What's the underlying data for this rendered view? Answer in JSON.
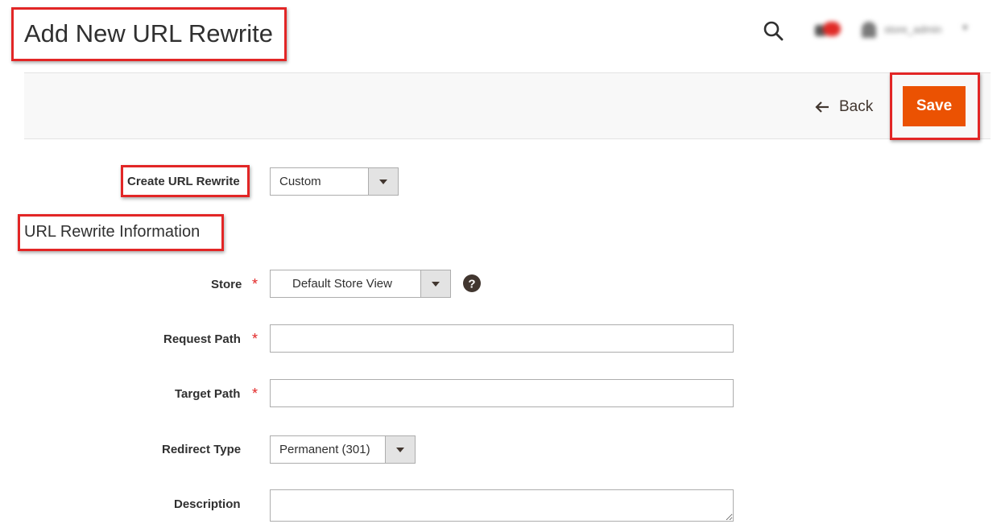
{
  "header": {
    "title": "Add New URL Rewrite",
    "user_name": "store_admin"
  },
  "action_bar": {
    "back_label": "Back",
    "save_label": "Save"
  },
  "form": {
    "create_url_rewrite": {
      "label": "Create URL Rewrite",
      "value": "Custom"
    },
    "section_title": "URL Rewrite Information",
    "store": {
      "label": "Store",
      "required_mark": "*",
      "value": "Default Store View"
    },
    "request_path": {
      "label": "Request Path",
      "required_mark": "*",
      "value": ""
    },
    "target_path": {
      "label": "Target Path",
      "required_mark": "*",
      "value": ""
    },
    "redirect_type": {
      "label": "Redirect Type",
      "value": "Permanent (301)"
    },
    "description": {
      "label": "Description",
      "value": ""
    }
  },
  "colors": {
    "accent": "#eb5202",
    "highlight": "#e22626",
    "required": "#e22626"
  },
  "icons": [
    "search-icon",
    "bell-icon",
    "user-icon",
    "back-arrow-icon",
    "help-icon",
    "chevron-down-icon"
  ]
}
